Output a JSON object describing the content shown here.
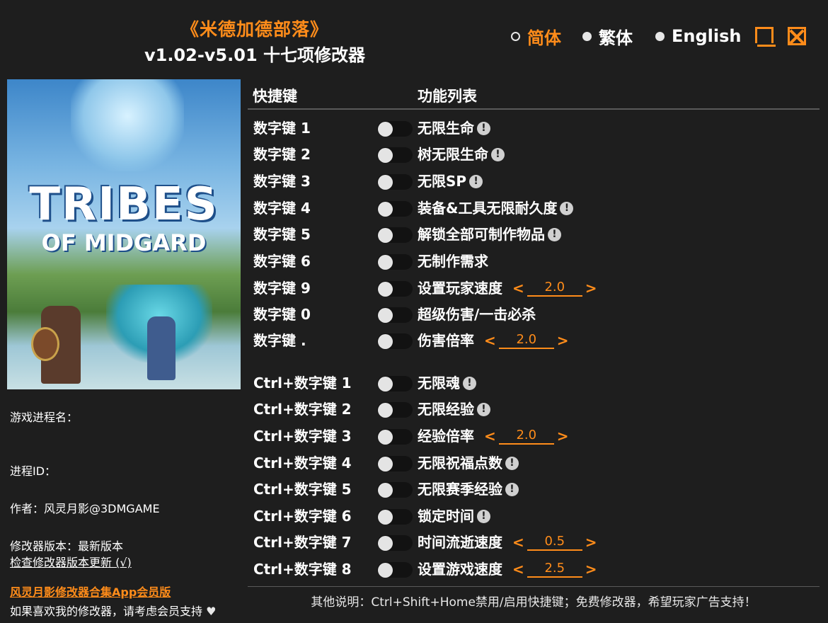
{
  "header": {
    "title": "《米德加德部落》",
    "subtitle": "v1.02-v5.01 十七项修改器"
  },
  "languages": [
    {
      "label": "简体",
      "selected": true
    },
    {
      "label": "繁体",
      "selected": false
    },
    {
      "label": "English",
      "selected": false
    }
  ],
  "cover": {
    "logo_line1": "TRIBES",
    "logo_line2": "OF MIDGARD"
  },
  "left": {
    "process_name": "游戏进程名：",
    "process_id": "进程ID：",
    "author": "作者：风灵月影@3DMGAME",
    "version": "修改器版本：最新版本",
    "check_update": "检查修改器版本更新 (√)",
    "app_link": "风灵月影修改器合集App会员版",
    "support": "如果喜欢我的修改器，请考虑会员支持",
    "heart_icon": "heart-icon"
  },
  "columns": {
    "hotkey": "快捷键",
    "function": "功能列表"
  },
  "cheats": [
    {
      "key": "数字键 1",
      "label": "无限生命",
      "warn": true
    },
    {
      "key": "数字键 2",
      "label": "树无限生命",
      "warn": true
    },
    {
      "key": "数字键 3",
      "label": "无限SP",
      "warn": true
    },
    {
      "key": "数字键 4",
      "label": "装备&工具无限耐久度",
      "warn": true
    },
    {
      "key": "数字键 5",
      "label": "解锁全部可制作物品",
      "warn": true
    },
    {
      "key": "数字键 6",
      "label": "无制作需求",
      "warn": false
    },
    {
      "key": "数字键 9",
      "label": "设置玩家速度",
      "warn": false,
      "value": "2.0"
    },
    {
      "key": "数字键 0",
      "label": "超级伤害/一击必杀",
      "warn": false
    },
    {
      "key": "数字键 .",
      "label": "伤害倍率",
      "warn": false,
      "value": "2.0"
    },
    {
      "key": "Ctrl+数字键 1",
      "label": "无限魂",
      "warn": true
    },
    {
      "key": "Ctrl+数字键 2",
      "label": "无限经验",
      "warn": true
    },
    {
      "key": "Ctrl+数字键 3",
      "label": "经验倍率",
      "warn": false,
      "value": "2.0"
    },
    {
      "key": "Ctrl+数字键 4",
      "label": "无限祝福点数",
      "warn": true
    },
    {
      "key": "Ctrl+数字键 5",
      "label": "无限赛季经验",
      "warn": true
    },
    {
      "key": "Ctrl+数字键 6",
      "label": "锁定时间",
      "warn": true
    },
    {
      "key": "Ctrl+数字键 7",
      "label": "时间流逝速度",
      "warn": false,
      "value": "0.5"
    },
    {
      "key": "Ctrl+数字键 8",
      "label": "设置游戏速度",
      "warn": false,
      "value": "2.5"
    }
  ],
  "toggle_states": [
    false,
    false,
    false,
    false,
    false,
    false,
    false,
    false,
    false,
    false,
    false,
    false,
    false,
    false,
    false,
    false,
    false
  ],
  "footer": "其他说明：Ctrl+Shift+Home禁用/启用快捷键；免费修改器，希望玩家广告支持！",
  "colors": {
    "accent": "#ff8c1a",
    "background": "#1e1e1e",
    "text": "#ffffff"
  }
}
